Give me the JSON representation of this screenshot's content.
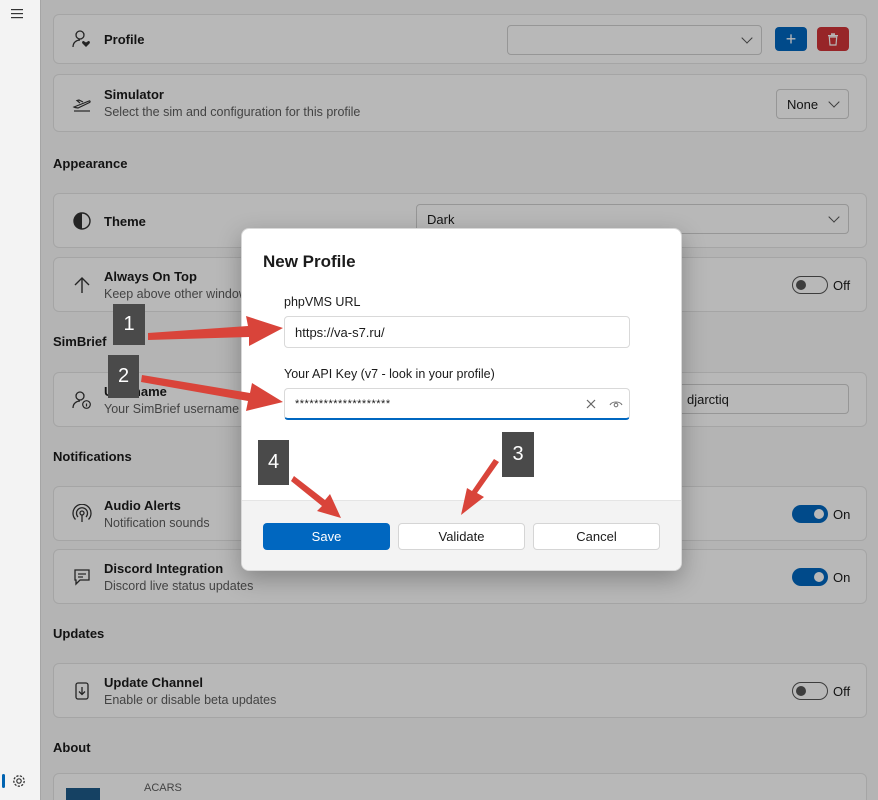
{
  "nav": {
    "menu_icon": "hamburger-icon",
    "settings_icon": "gear-icon"
  },
  "profile": {
    "title": "Profile",
    "select_value": "",
    "add_label": "+",
    "delete_icon": "trash-icon"
  },
  "simulator": {
    "title": "Simulator",
    "subtitle": "Select the sim and configuration for this profile",
    "value": "None"
  },
  "sections": {
    "appearance": "Appearance",
    "simbrief": "SimBrief",
    "notifications": "Notifications",
    "updates": "Updates",
    "about": "About"
  },
  "theme": {
    "title": "Theme",
    "value": "Dark"
  },
  "always_on_top": {
    "title": "Always On Top",
    "subtitle": "Keep above other windows",
    "state": "Off"
  },
  "simbrief_user": {
    "title": "Username",
    "subtitle": "Your SimBrief username",
    "value": "djarctiq"
  },
  "audio_alerts": {
    "title": "Audio Alerts",
    "subtitle": "Notification sounds",
    "state": "On"
  },
  "discord": {
    "title": "Discord Integration",
    "subtitle": "Discord live status updates",
    "state": "On"
  },
  "update_channel": {
    "title": "Update Channel",
    "subtitle": "Enable or disable beta updates",
    "state": "Off"
  },
  "about_card": {
    "partial_text": "ACARS"
  },
  "dialog": {
    "title": "New Profile",
    "url_label": "phpVMS URL",
    "url_value": "https://va-s7.ru/",
    "api_label": "Your API Key (v7 - look in your profile)",
    "api_value": "********************",
    "save": "Save",
    "validate": "Validate",
    "cancel": "Cancel"
  },
  "callouts": [
    "1",
    "2",
    "3",
    "4"
  ],
  "colors": {
    "accent": "#0067c0",
    "danger": "#d13438",
    "callout_arrow": "#d9443a",
    "callout_badge": "#4a4a4a"
  }
}
